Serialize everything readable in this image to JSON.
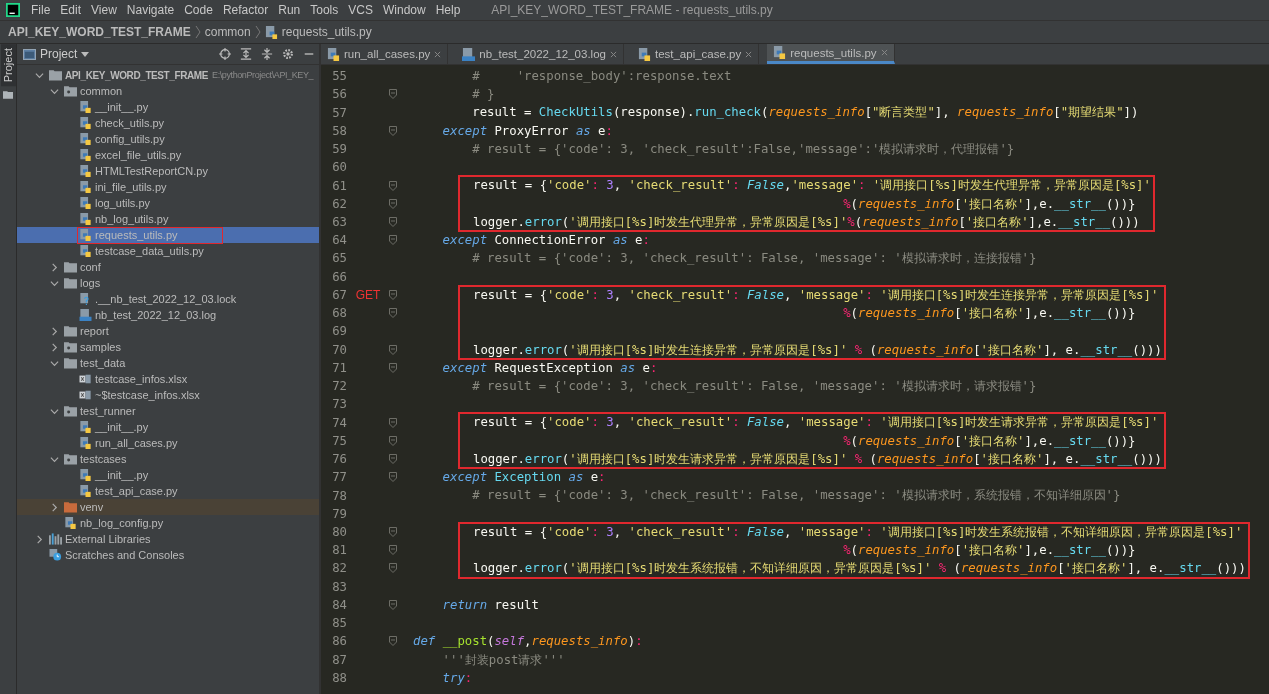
{
  "menu": {
    "items": [
      "File",
      "Edit",
      "View",
      "Navigate",
      "Code",
      "Refactor",
      "Run",
      "Tools",
      "VCS",
      "Window",
      "Help"
    ]
  },
  "window": {
    "title": "API_KEY_WORD_TEST_FRAME - requests_utils.py"
  },
  "breadcrumb": [
    "API_KEY_WORD_TEST_FRAME",
    "common",
    "requests_utils.py"
  ],
  "side_tab": "Project",
  "project": {
    "title": "Project",
    "tree": [
      {
        "label": "API_KEY_WORD_TEST_FRAME",
        "path": "E:\\pythonProject\\API_KEY_",
        "kind": "project",
        "expanded": true,
        "selected": false,
        "annotated": false,
        "children": [
          {
            "label": "common",
            "kind": "package",
            "expanded": true,
            "selected": false,
            "annotated": false,
            "children": [
              {
                "label": "__init__.py",
                "kind": "python",
                "selected": false,
                "annotated": false
              },
              {
                "label": "check_utils.py",
                "kind": "python",
                "selected": false,
                "annotated": false
              },
              {
                "label": "config_utils.py",
                "kind": "python",
                "selected": false,
                "annotated": false
              },
              {
                "label": "excel_file_utils.py",
                "kind": "python",
                "selected": false,
                "annotated": false
              },
              {
                "label": "HTMLTestReportCN.py",
                "kind": "python",
                "selected": false,
                "annotated": false
              },
              {
                "label": "ini_file_utils.py",
                "kind": "python",
                "selected": false,
                "annotated": false
              },
              {
                "label": "log_utils.py",
                "kind": "python",
                "selected": false,
                "annotated": false
              },
              {
                "label": "nb_log_utils.py",
                "kind": "python",
                "selected": false,
                "annotated": false
              },
              {
                "label": "requests_utils.py",
                "kind": "python",
                "selected": true,
                "annotated": true
              },
              {
                "label": "testcase_data_utils.py",
                "kind": "python",
                "selected": false,
                "annotated": false
              }
            ]
          },
          {
            "label": "conf",
            "kind": "folder",
            "expanded": false,
            "selected": false,
            "annotated": false
          },
          {
            "label": "logs",
            "kind": "folder",
            "expanded": true,
            "selected": false,
            "annotated": false,
            "children": [
              {
                "label": ".__nb_test_2022_12_03.lock",
                "kind": "lock",
                "selected": false,
                "annotated": false
              },
              {
                "label": "nb_test_2022_12_03.log",
                "kind": "log",
                "selected": false,
                "annotated": false
              }
            ]
          },
          {
            "label": "report",
            "kind": "folder",
            "expanded": false,
            "selected": false,
            "annotated": false
          },
          {
            "label": "samples",
            "kind": "package",
            "expanded": false,
            "selected": false,
            "annotated": false
          },
          {
            "label": "test_data",
            "kind": "folder",
            "expanded": true,
            "selected": false,
            "annotated": false,
            "children": [
              {
                "label": "testcase_infos.xlsx",
                "kind": "excel",
                "selected": false,
                "annotated": false
              },
              {
                "label": "~$testcase_infos.xlsx",
                "kind": "excel",
                "selected": false,
                "annotated": false
              }
            ]
          },
          {
            "label": "test_runner",
            "kind": "package",
            "expanded": true,
            "selected": false,
            "annotated": false,
            "children": [
              {
                "label": "__init__.py",
                "kind": "python",
                "selected": false,
                "annotated": false
              },
              {
                "label": "run_all_cases.py",
                "kind": "python",
                "selected": false,
                "annotated": false
              }
            ]
          },
          {
            "label": "testcases",
            "kind": "package",
            "expanded": true,
            "selected": false,
            "annotated": false,
            "children": [
              {
                "label": "__init__.py",
                "kind": "python",
                "selected": false,
                "annotated": false
              },
              {
                "label": "test_api_case.py",
                "kind": "python",
                "selected": false,
                "annotated": false
              }
            ]
          },
          {
            "label": "venv",
            "kind": "excluded",
            "expanded": false,
            "selected": false,
            "annotated": false
          },
          {
            "label": "nb_log_config.py",
            "kind": "python",
            "selected": false,
            "annotated": false
          }
        ]
      },
      {
        "label": "External Libraries",
        "kind": "libraries",
        "expanded": false,
        "selected": false,
        "annotated": false
      },
      {
        "label": "Scratches and Consoles",
        "kind": "scratches",
        "selected": false,
        "annotated": false
      }
    ]
  },
  "tabs": [
    {
      "label": "run_all_cases.py",
      "kind": "python",
      "selected": false
    },
    {
      "label": "nb_test_2022_12_03.log",
      "kind": "log",
      "selected": false
    },
    {
      "label": "test_api_case.py",
      "kind": "python",
      "selected": false
    },
    {
      "label": "requests_utils.py",
      "kind": "python",
      "selected": true
    }
  ],
  "code": {
    "blocks": [
      {
        "annotated": false,
        "lines": [
          {
            "number": "55",
            "fold": false,
            "spans": [
              {
                "kind": "c",
                "text": "        #     'response_body':response.text"
              }
            ]
          },
          {
            "number": "56",
            "fold": true,
            "spans": [
              {
                "kind": "c",
                "text": "        # }"
              }
            ]
          },
          {
            "number": "57",
            "fold": false,
            "spans": [
              {
                "kind": "p",
                "text": "        result = "
              },
              {
                "kind": "f",
                "text": "CheckUtils"
              },
              {
                "kind": "p",
                "text": "(response)."
              },
              {
                "kind": "f",
                "text": "run_check"
              },
              {
                "kind": "p",
                "text": "("
              },
              {
                "kind": "a",
                "text": "requests_info"
              },
              {
                "kind": "p",
                "text": "["
              },
              {
                "kind": "s",
                "text": "\"断言类型\""
              },
              {
                "kind": "p",
                "text": "], "
              },
              {
                "kind": "a",
                "text": "requests_info"
              },
              {
                "kind": "p",
                "text": "["
              },
              {
                "kind": "s",
                "text": "\"期望结果\""
              },
              {
                "kind": "p",
                "text": "])"
              }
            ]
          },
          {
            "number": "58",
            "fold": true,
            "spans": [
              {
                "kind": "k",
                "text": "    except"
              },
              {
                "kind": "p",
                "text": " ProxyError "
              },
              {
                "kind": "k",
                "text": "as"
              },
              {
                "kind": "p",
                "text": " e"
              },
              {
                "kind": "o",
                "text": ":"
              }
            ]
          },
          {
            "number": "59",
            "fold": false,
            "spans": [
              {
                "kind": "c",
                "text": "        # result = {'code': 3, 'check_result':False,'message':'模拟请求时，代理报错'}"
              }
            ]
          },
          {
            "number": "60",
            "fold": false
          }
        ]
      },
      {
        "annotated": true,
        "lines": [
          {
            "number": "61",
            "fold": true,
            "spans": [
              {
                "kind": "p",
                "text": "result = {"
              },
              {
                "kind": "s",
                "text": "'code'"
              },
              {
                "kind": "o",
                "text": ": "
              },
              {
                "kind": "n",
                "text": "3"
              },
              {
                "kind": "p",
                "text": ", "
              },
              {
                "kind": "s",
                "text": "'check_result'"
              },
              {
                "kind": "o",
                "text": ": "
              },
              {
                "kind": "b",
                "text": "False"
              },
              {
                "kind": "p",
                "text": ","
              },
              {
                "kind": "s",
                "text": "'message'"
              },
              {
                "kind": "o",
                "text": ": "
              },
              {
                "kind": "s",
                "text": "'调用接口[%s]时发生代理异常，异常原因是[%s]'"
              }
            ]
          },
          {
            "number": "62",
            "fold": true,
            "spans": [
              {
                "kind": "o",
                "text": "                                                  %"
              },
              {
                "kind": "p",
                "text": "("
              },
              {
                "kind": "a",
                "text": "requests_info"
              },
              {
                "kind": "p",
                "text": "["
              },
              {
                "kind": "s",
                "text": "'接口名称'"
              },
              {
                "kind": "p",
                "text": "],e."
              },
              {
                "kind": "d",
                "text": "__str__"
              },
              {
                "kind": "p",
                "text": "())}"
              }
            ]
          },
          {
            "number": "63",
            "fold": true,
            "spans": [
              {
                "kind": "p",
                "text": "logger."
              },
              {
                "kind": "f",
                "text": "error"
              },
              {
                "kind": "p",
                "text": "("
              },
              {
                "kind": "s",
                "text": "'调用接口[%s]时发生代理异常，异常原因是[%s]'"
              },
              {
                "kind": "o",
                "text": "%"
              },
              {
                "kind": "p",
                "text": "("
              },
              {
                "kind": "a",
                "text": "requests_info"
              },
              {
                "kind": "p",
                "text": "["
              },
              {
                "kind": "s",
                "text": "'接口名称'"
              },
              {
                "kind": "p",
                "text": "],e."
              },
              {
                "kind": "d",
                "text": "__str__"
              },
              {
                "kind": "p",
                "text": "()))"
              }
            ]
          }
        ]
      },
      {
        "annotated": false,
        "lines": [
          {
            "number": "64",
            "fold": true,
            "spans": [
              {
                "kind": "k",
                "text": "    except"
              },
              {
                "kind": "p",
                "text": " ConnectionError "
              },
              {
                "kind": "k",
                "text": "as"
              },
              {
                "kind": "p",
                "text": " e"
              },
              {
                "kind": "o",
                "text": ":"
              }
            ]
          },
          {
            "number": "65",
            "fold": false,
            "spans": [
              {
                "kind": "c",
                "text": "        # result = {'code': 3, 'check_result': False, 'message': '模拟请求时，连接报错'}"
              }
            ]
          },
          {
            "number": "66",
            "fold": false
          }
        ]
      },
      {
        "annotated": true,
        "lines": [
          {
            "number": "67",
            "fold": true,
            "gutter_label": "GET",
            "spans": [
              {
                "kind": "p",
                "text": "result = {"
              },
              {
                "kind": "s",
                "text": "'code'"
              },
              {
                "kind": "o",
                "text": ": "
              },
              {
                "kind": "n",
                "text": "3"
              },
              {
                "kind": "p",
                "text": ", "
              },
              {
                "kind": "s",
                "text": "'check_result'"
              },
              {
                "kind": "o",
                "text": ": "
              },
              {
                "kind": "b",
                "text": "False"
              },
              {
                "kind": "p",
                "text": ", "
              },
              {
                "kind": "s",
                "text": "'message'"
              },
              {
                "kind": "o",
                "text": ": "
              },
              {
                "kind": "s",
                "text": "'调用接口[%s]时发生连接异常，异常原因是[%s]'"
              }
            ]
          },
          {
            "number": "68",
            "fold": true,
            "spans": [
              {
                "kind": "o",
                "text": "                                                  %"
              },
              {
                "kind": "p",
                "text": "("
              },
              {
                "kind": "a",
                "text": "requests_info"
              },
              {
                "kind": "p",
                "text": "["
              },
              {
                "kind": "s",
                "text": "'接口名称'"
              },
              {
                "kind": "p",
                "text": "],e."
              },
              {
                "kind": "d",
                "text": "__str__"
              },
              {
                "kind": "p",
                "text": "())}"
              }
            ]
          },
          {
            "number": "69",
            "fold": false
          },
          {
            "number": "70",
            "fold": true,
            "spans": [
              {
                "kind": "p",
                "text": "logger."
              },
              {
                "kind": "f",
                "text": "error"
              },
              {
                "kind": "p",
                "text": "("
              },
              {
                "kind": "s",
                "text": "'调用接口[%s]时发生连接异常，异常原因是[%s]'"
              },
              {
                "kind": "o",
                "text": " %"
              },
              {
                "kind": "p",
                "text": " ("
              },
              {
                "kind": "a",
                "text": "requests_info"
              },
              {
                "kind": "p",
                "text": "["
              },
              {
                "kind": "s",
                "text": "'接口名称'"
              },
              {
                "kind": "p",
                "text": "], e."
              },
              {
                "kind": "d",
                "text": "__str__"
              },
              {
                "kind": "p",
                "text": "()))"
              }
            ]
          }
        ]
      },
      {
        "annotated": false,
        "lines": [
          {
            "number": "71",
            "fold": true,
            "spans": [
              {
                "kind": "k",
                "text": "    except"
              },
              {
                "kind": "p",
                "text": " RequestException "
              },
              {
                "kind": "k",
                "text": "as"
              },
              {
                "kind": "p",
                "text": " e"
              },
              {
                "kind": "o",
                "text": ":"
              }
            ]
          },
          {
            "number": "72",
            "fold": false,
            "spans": [
              {
                "kind": "c",
                "text": "        # result = {'code': 3, 'check_result': False, 'message': '模拟请求时，请求报错'}"
              }
            ]
          },
          {
            "number": "73",
            "fold": false
          }
        ]
      },
      {
        "annotated": true,
        "lines": [
          {
            "number": "74",
            "fold": true,
            "spans": [
              {
                "kind": "p",
                "text": "result = {"
              },
              {
                "kind": "s",
                "text": "'code'"
              },
              {
                "kind": "o",
                "text": ": "
              },
              {
                "kind": "n",
                "text": "3"
              },
              {
                "kind": "p",
                "text": ", "
              },
              {
                "kind": "s",
                "text": "'check_result'"
              },
              {
                "kind": "o",
                "text": ": "
              },
              {
                "kind": "b",
                "text": "False"
              },
              {
                "kind": "p",
                "text": ", "
              },
              {
                "kind": "s",
                "text": "'message'"
              },
              {
                "kind": "o",
                "text": ": "
              },
              {
                "kind": "s",
                "text": "'调用接口[%s]时发生请求异常，异常原因是[%s]'"
              }
            ]
          },
          {
            "number": "75",
            "fold": true,
            "spans": [
              {
                "kind": "o",
                "text": "                                                  %"
              },
              {
                "kind": "p",
                "text": "("
              },
              {
                "kind": "a",
                "text": "requests_info"
              },
              {
                "kind": "p",
                "text": "["
              },
              {
                "kind": "s",
                "text": "'接口名称'"
              },
              {
                "kind": "p",
                "text": "],e."
              },
              {
                "kind": "d",
                "text": "__str__"
              },
              {
                "kind": "p",
                "text": "())}"
              }
            ]
          },
          {
            "number": "76",
            "fold": true,
            "spans": [
              {
                "kind": "p",
                "text": "logger."
              },
              {
                "kind": "f",
                "text": "error"
              },
              {
                "kind": "p",
                "text": "("
              },
              {
                "kind": "s",
                "text": "'调用接口[%s]时发生请求异常，异常原因是[%s]'"
              },
              {
                "kind": "o",
                "text": " %"
              },
              {
                "kind": "p",
                "text": " ("
              },
              {
                "kind": "a",
                "text": "requests_info"
              },
              {
                "kind": "p",
                "text": "["
              },
              {
                "kind": "s",
                "text": "'接口名称'"
              },
              {
                "kind": "p",
                "text": "], e."
              },
              {
                "kind": "d",
                "text": "__str__"
              },
              {
                "kind": "p",
                "text": "()))"
              }
            ]
          }
        ]
      },
      {
        "annotated": false,
        "lines": [
          {
            "number": "77",
            "fold": true,
            "spans": [
              {
                "kind": "k",
                "text": "    except "
              },
              {
                "kind": "f",
                "text": "Exception"
              },
              {
                "kind": "k",
                "text": " as"
              },
              {
                "kind": "p",
                "text": " e"
              },
              {
                "kind": "o",
                "text": ":"
              }
            ]
          },
          {
            "number": "78",
            "fold": false,
            "spans": [
              {
                "kind": "c",
                "text": "        # result = {'code': 3, 'check_result': False, 'message': '模拟请求时，系统报错，不知详细原因'}"
              }
            ]
          },
          {
            "number": "79",
            "fold": false
          }
        ]
      },
      {
        "annotated": true,
        "lines": [
          {
            "number": "80",
            "fold": true,
            "spans": [
              {
                "kind": "p",
                "text": "result = {"
              },
              {
                "kind": "s",
                "text": "'code'"
              },
              {
                "kind": "o",
                "text": ": "
              },
              {
                "kind": "n",
                "text": "3"
              },
              {
                "kind": "p",
                "text": ", "
              },
              {
                "kind": "s",
                "text": "'check_result'"
              },
              {
                "kind": "o",
                "text": ": "
              },
              {
                "kind": "b",
                "text": "False"
              },
              {
                "kind": "p",
                "text": ", "
              },
              {
                "kind": "s",
                "text": "'message'"
              },
              {
                "kind": "o",
                "text": ": "
              },
              {
                "kind": "s",
                "text": "'调用接口[%s]时发生系统报错，不知详细原因，异常原因是[%s]'"
              }
            ]
          },
          {
            "number": "81",
            "fold": true,
            "spans": [
              {
                "kind": "o",
                "text": "                                                  %"
              },
              {
                "kind": "p",
                "text": "("
              },
              {
                "kind": "a",
                "text": "requests_info"
              },
              {
                "kind": "p",
                "text": "["
              },
              {
                "kind": "s",
                "text": "'接口名称'"
              },
              {
                "kind": "p",
                "text": "],e."
              },
              {
                "kind": "d",
                "text": "__str__"
              },
              {
                "kind": "p",
                "text": "())}"
              }
            ]
          },
          {
            "number": "82",
            "fold": true,
            "spans": [
              {
                "kind": "p",
                "text": "logger."
              },
              {
                "kind": "f",
                "text": "error"
              },
              {
                "kind": "p",
                "text": "("
              },
              {
                "kind": "s",
                "text": "'调用接口[%s]时发生系统报错，不知详细原因，异常原因是[%s]'"
              },
              {
                "kind": "o",
                "text": " %"
              },
              {
                "kind": "p",
                "text": " ("
              },
              {
                "kind": "a",
                "text": "requests_info"
              },
              {
                "kind": "p",
                "text": "["
              },
              {
                "kind": "s",
                "text": "'接口名称'"
              },
              {
                "kind": "p",
                "text": "], e."
              },
              {
                "kind": "d",
                "text": "__str__"
              },
              {
                "kind": "p",
                "text": "()))"
              }
            ]
          }
        ]
      },
      {
        "annotated": false,
        "lines": [
          {
            "number": "83",
            "fold": false
          },
          {
            "number": "84",
            "fold": true,
            "spans": [
              {
                "kind": "k",
                "text": "    return"
              },
              {
                "kind": "p",
                "text": " result"
              }
            ]
          },
          {
            "number": "85",
            "fold": false
          },
          {
            "number": "86",
            "fold": true,
            "spans": [
              {
                "kind": "k",
                "text": "def "
              },
              {
                "kind": "g",
                "text": "__post"
              },
              {
                "kind": "p",
                "text": "("
              },
              {
                "kind": "m",
                "text": "self"
              },
              {
                "kind": "p",
                "text": ","
              },
              {
                "kind": "a",
                "text": "requests_info"
              },
              {
                "kind": "p",
                "text": ")"
              },
              {
                "kind": "o",
                "text": ":"
              }
            ]
          },
          {
            "number": "87",
            "fold": false,
            "spans": [
              {
                "kind": "c",
                "text": "    '''封装post请求'''"
              }
            ]
          },
          {
            "number": "88",
            "fold": false,
            "spans": [
              {
                "kind": "k",
                "text": "    try"
              },
              {
                "kind": "o",
                "text": ":"
              }
            ]
          }
        ]
      }
    ]
  }
}
